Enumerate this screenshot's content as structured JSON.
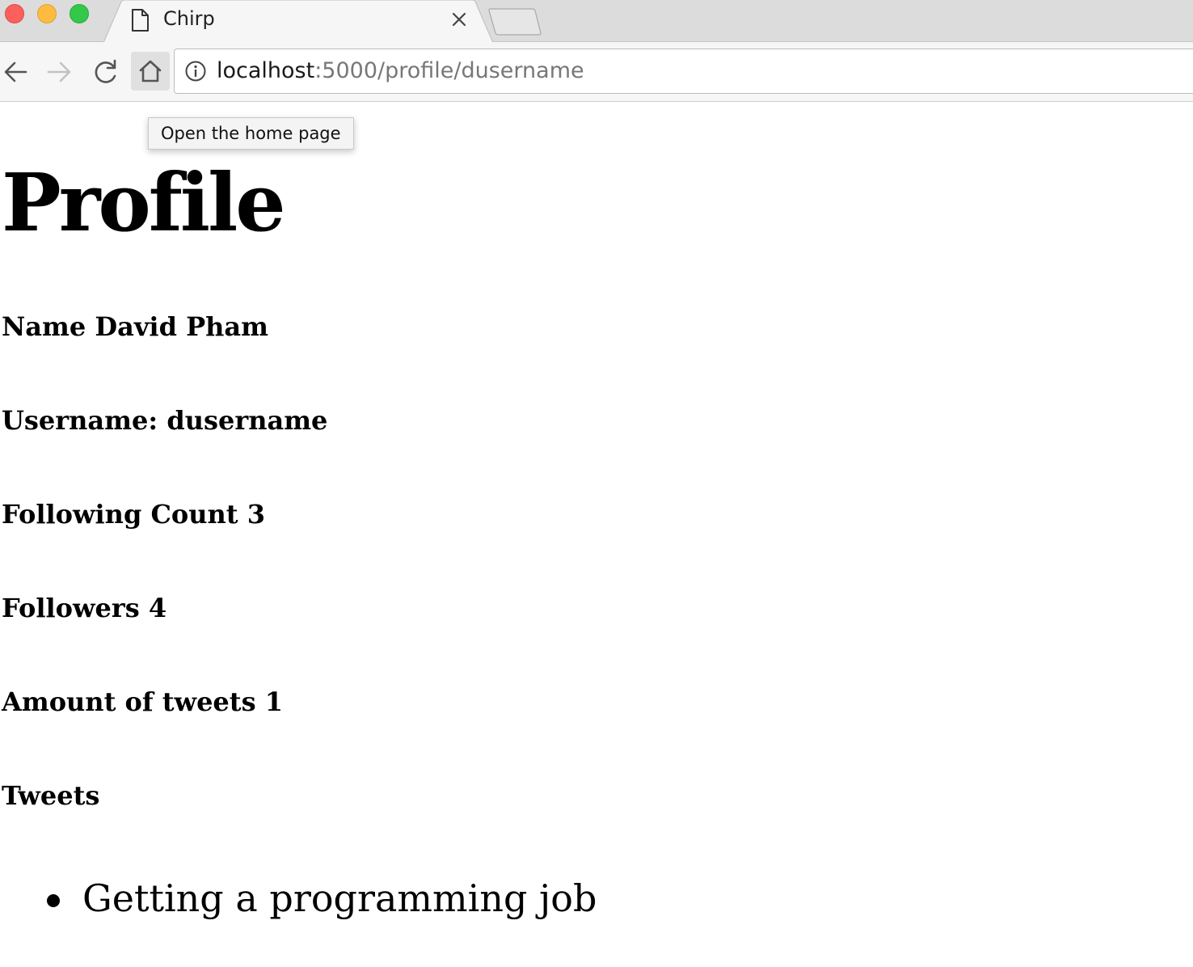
{
  "browser": {
    "tab": {
      "title": "Chirp",
      "icon": "document-icon",
      "close_icon": "close-icon"
    },
    "new_tab_icon": "new-tab-icon",
    "nav": {
      "back_icon": "arrow-left-icon",
      "forward_icon": "arrow-right-icon",
      "reload_icon": "reload-icon",
      "home_icon": "home-icon"
    },
    "address_bar": {
      "info_icon": "info-icon",
      "host": "localhost",
      "path": ":5000/profile/dusername"
    },
    "tooltip": "Open the home page",
    "colors": {
      "close": "#fc605c",
      "minimize": "#fdbc40",
      "maximize": "#34c84a"
    }
  },
  "page": {
    "title": "Profile",
    "name_line": "Name David Pham",
    "username_line": "Username: dusername",
    "following_line": "Following Count 3",
    "followers_line": "Followers 4",
    "tweet_count_line": "Amount of tweets 1",
    "tweets_heading": "Tweets",
    "tweets": [
      "Getting a programming job"
    ]
  }
}
